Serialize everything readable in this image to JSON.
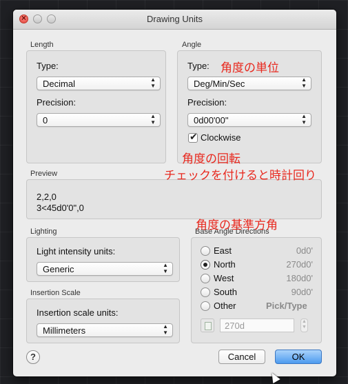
{
  "window": {
    "title": "Drawing Units"
  },
  "length": {
    "section_title": "Length",
    "type_label": "Type:",
    "type_value": "Decimal",
    "precision_label": "Precision:",
    "precision_value": "0"
  },
  "angle": {
    "section_title": "Angle",
    "type_label": "Type:",
    "type_value": "Deg/Min/Sec",
    "precision_label": "Precision:",
    "precision_value": "0d00'00\"",
    "clockwise_label": "Clockwise",
    "clockwise_checked": true
  },
  "preview": {
    "section_title": "Preview",
    "line1": "2,2,0",
    "line2": "3<45d0'0\",0"
  },
  "lighting": {
    "section_title": "Lighting",
    "units_label": "Light intensity units:",
    "units_value": "Generic"
  },
  "insertion": {
    "section_title": "Insertion Scale",
    "units_label": "Insertion scale units:",
    "units_value": "Millimeters"
  },
  "base_angle": {
    "section_title": "Base Angle Directions",
    "options": [
      {
        "label": "East",
        "value": "0d0'",
        "selected": false
      },
      {
        "label": "North",
        "value": "270d0'",
        "selected": true
      },
      {
        "label": "West",
        "value": "180d0'",
        "selected": false
      },
      {
        "label": "South",
        "value": "90d0'",
        "selected": false
      },
      {
        "label": "Other",
        "value": "Pick/Type",
        "selected": false
      }
    ],
    "custom_angle_placeholder": "270d"
  },
  "buttons": {
    "help": "?",
    "cancel": "Cancel",
    "ok": "OK"
  },
  "annotations": {
    "angle_unit": "角度の単位",
    "angle_rotation": "角度の回転",
    "clockwise_note": "チェックを付けると時計回り",
    "base_angle": "角度の基準方角",
    "color": "#e8281e"
  },
  "icons": {
    "close": "close-icon",
    "minimize": "minimize-icon",
    "zoom": "zoom-icon",
    "pick": "pick-point-icon",
    "help": "help-icon"
  }
}
